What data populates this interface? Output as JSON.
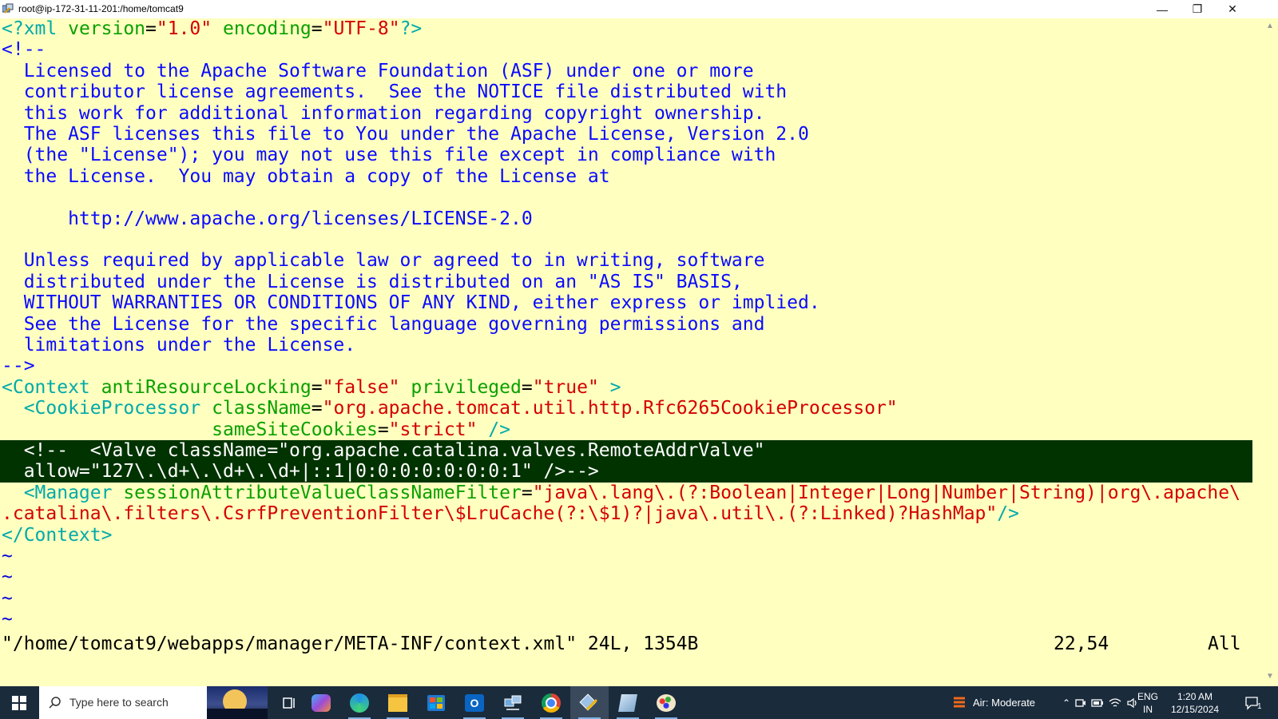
{
  "window": {
    "title": "root@ip-172-31-11-201:/home/tomcat9",
    "minimize": "—",
    "restore": "❐",
    "close": "✕"
  },
  "editor": {
    "lines": [
      [
        {
          "t": "<?xml ",
          "c": "cy"
        },
        {
          "t": "version",
          "c": "g"
        },
        {
          "t": "=",
          "c": "k"
        },
        {
          "t": "\"1.0\"",
          "c": "r"
        },
        {
          "t": " encoding",
          "c": "g"
        },
        {
          "t": "=",
          "c": "k"
        },
        {
          "t": "\"UTF-8\"",
          "c": "r"
        },
        {
          "t": "?>",
          "c": "cy"
        }
      ],
      [
        {
          "t": "<!--",
          "c": "b"
        }
      ],
      [
        {
          "t": "  Licensed to the Apache Software Foundation (ASF) under one or more",
          "c": "b"
        }
      ],
      [
        {
          "t": "  contributor license agreements.  See the NOTICE file distributed with",
          "c": "b"
        }
      ],
      [
        {
          "t": "  this work for additional information regarding copyright ownership.",
          "c": "b"
        }
      ],
      [
        {
          "t": "  The ASF licenses this file to You under the Apache License, Version 2.0",
          "c": "b"
        }
      ],
      [
        {
          "t": "  (the \"License\"); you may not use this file except in compliance with",
          "c": "b"
        }
      ],
      [
        {
          "t": "  the License.  You may obtain a copy of the License at",
          "c": "b"
        }
      ],
      [
        {
          "t": "",
          "c": "b"
        }
      ],
      [
        {
          "t": "      http://www.apache.org/licenses/LICENSE-2.0",
          "c": "b"
        }
      ],
      [
        {
          "t": "",
          "c": "b"
        }
      ],
      [
        {
          "t": "  Unless required by applicable law or agreed to in writing, software",
          "c": "b"
        }
      ],
      [
        {
          "t": "  distributed under the License is distributed on an \"AS IS\" BASIS,",
          "c": "b"
        }
      ],
      [
        {
          "t": "  WITHOUT WARRANTIES OR CONDITIONS OF ANY KIND, either express or implied.",
          "c": "b"
        }
      ],
      [
        {
          "t": "  See the License for the specific language governing permissions and",
          "c": "b"
        }
      ],
      [
        {
          "t": "  limitations under the License.",
          "c": "b"
        }
      ],
      [
        {
          "t": "-->",
          "c": "b"
        }
      ],
      [
        {
          "t": "<Context",
          "c": "cy"
        },
        {
          "t": " antiResourceLocking",
          "c": "g"
        },
        {
          "t": "=",
          "c": "k"
        },
        {
          "t": "\"false\"",
          "c": "r"
        },
        {
          "t": " privileged",
          "c": "g"
        },
        {
          "t": "=",
          "c": "k"
        },
        {
          "t": "\"true\"",
          "c": "r"
        },
        {
          "t": " >",
          "c": "cy"
        }
      ],
      [
        {
          "t": "  <CookieProcessor",
          "c": "cy"
        },
        {
          "t": " className",
          "c": "g"
        },
        {
          "t": "=",
          "c": "k"
        },
        {
          "t": "\"org.apache.tomcat.util.http.Rfc6265CookieProcessor\"",
          "c": "r"
        }
      ],
      [
        {
          "t": "                   sameSiteCookies",
          "c": "g"
        },
        {
          "t": "=",
          "c": "k"
        },
        {
          "t": "\"strict\"",
          "c": "r"
        },
        {
          "t": " />",
          "c": "cy"
        }
      ],
      [
        {
          "t": "  ",
          "c": "k"
        },
        {
          "t": "<!--  <Valve className=\"org.apache.catalina.valves.RemoteAddrValve\"",
          "c": "sel"
        }
      ],
      [
        {
          "t": "  allow=\"127\\.\\d+\\.\\d+\\.\\d+|::1|0:0:0:0:0:0:0:1\" />-->",
          "c": "sel"
        }
      ],
      [
        {
          "t": "  <Manager",
          "c": "cy"
        },
        {
          "t": " sessionAttributeValueClassNameFilter",
          "c": "g"
        },
        {
          "t": "=",
          "c": "k"
        },
        {
          "t": "\"java\\.lang\\.(?:Boolean|Integer|Long|Number|String)|org\\.apache\\",
          "c": "r"
        }
      ],
      [
        {
          "t": ".catalina\\.filters\\.CsrfPreventionFilter\\$LruCache(?:\\$1)?|java\\.util\\.(?:Linked)?HashMap\"",
          "c": "r"
        },
        {
          "t": "/>",
          "c": "cy"
        }
      ],
      [
        {
          "t": "</Context>",
          "c": "cy"
        }
      ],
      [
        {
          "t": "~",
          "c": "bl"
        }
      ],
      [
        {
          "t": "~",
          "c": "bl"
        }
      ],
      [
        {
          "t": "~",
          "c": "bl"
        }
      ],
      [
        {
          "t": "~",
          "c": "bl"
        }
      ]
    ],
    "status_file": "\"/home/tomcat9/webapps/manager/META-INF/context.xml\" 24L, 1354B",
    "status_pos": "22,54",
    "status_all": "All"
  },
  "taskbar": {
    "search_placeholder": "Type here to search",
    "weather": "Air: Moderate",
    "lang_top": "ENG",
    "lang_bottom": "IN",
    "time": "1:20 AM",
    "date": "12/15/2024",
    "notif_count": "1"
  }
}
